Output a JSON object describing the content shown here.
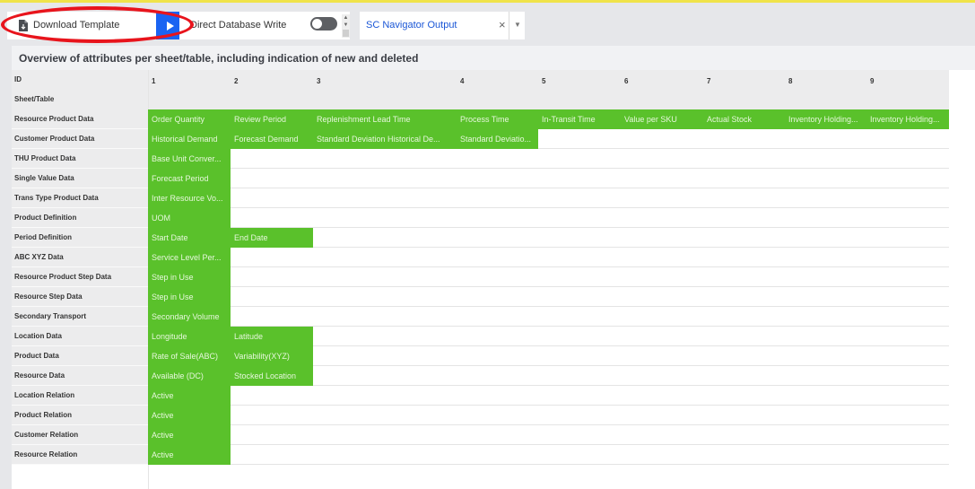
{
  "toolbar": {
    "download_template_label": "Download Template",
    "direct_db_write_label": "Direct Database Write",
    "direct_db_write_enabled": false,
    "output_select_value": "SC Navigator Output",
    "clear_glyph": "×",
    "caret_glyph": "▼",
    "icons": [
      "file-download-icon",
      "play-icon",
      "close-icon",
      "chevron-down-icon",
      "spinner-up-icon"
    ]
  },
  "header": {
    "title": "Overview of attributes per sheet/table, including indication of new and deleted",
    "id_label": "ID",
    "sheet_label": "Sheet/Table",
    "columns": [
      "1",
      "2",
      "3",
      "4",
      "5",
      "6",
      "7",
      "8",
      "9"
    ]
  },
  "colors": {
    "green": "#5ac12b",
    "run_button_blue": "#1a63f2",
    "annotation_red": "#e8141c"
  },
  "rows": [
    {
      "label": "Resource Product Data",
      "cells": [
        "Order Quantity",
        "Review Period",
        "Replenishment Lead Time",
        "Process Time",
        "In-Transit Time",
        "Value per SKU",
        "Actual Stock",
        "Inventory Holding...",
        "Inventory Holding..."
      ]
    },
    {
      "label": "Customer Product Data",
      "cells": [
        "Historical Demand",
        "Forecast Demand",
        "Standard Deviation Historical De...",
        "Standard Deviatio..."
      ]
    },
    {
      "label": "THU Product Data",
      "cells": [
        "Base Unit Conver..."
      ]
    },
    {
      "label": "Single Value Data",
      "cells": [
        "Forecast Period"
      ]
    },
    {
      "label": "Trans Type Product Data",
      "cells": [
        "Inter Resource Vo..."
      ]
    },
    {
      "label": "Product Definition",
      "cells": [
        "UOM"
      ]
    },
    {
      "label": "Period Definition",
      "cells": [
        "Start Date",
        "End Date"
      ]
    },
    {
      "label": "ABC XYZ Data",
      "cells": [
        "Service Level Per..."
      ]
    },
    {
      "label": "Resource Product Step Data",
      "cells": [
        "Step in Use"
      ]
    },
    {
      "label": "Resource Step Data",
      "cells": [
        "Step in Use"
      ]
    },
    {
      "label": "Secondary Transport",
      "cells": [
        "Secondary Volume"
      ]
    },
    {
      "label": "Location Data",
      "cells": [
        "Longitude",
        "Latitude"
      ]
    },
    {
      "label": "Product Data",
      "cells": [
        "Rate of Sale(ABC)",
        "Variability(XYZ)"
      ]
    },
    {
      "label": "Resource Data",
      "cells": [
        "Available (DC)",
        "Stocked Location"
      ]
    },
    {
      "label": "Location Relation",
      "cells": [
        "Active"
      ]
    },
    {
      "label": "Product Relation",
      "cells": [
        "Active"
      ]
    },
    {
      "label": "Customer Relation",
      "cells": [
        "Active"
      ]
    },
    {
      "label": "Resource Relation",
      "cells": [
        "Active"
      ]
    }
  ]
}
